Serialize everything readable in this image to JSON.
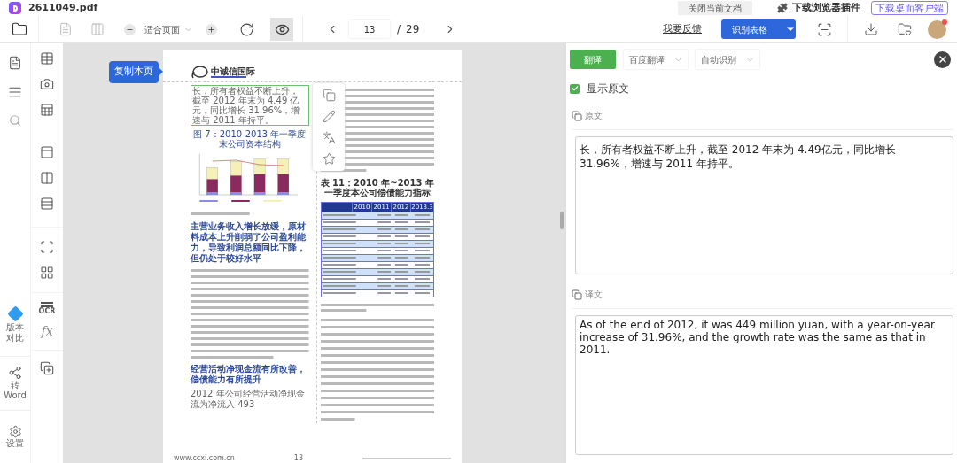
{
  "title_bar": {
    "filename": "2611049.pdf",
    "close_doc": "关闭当前文档",
    "plugin_link": "下载浏览器插件",
    "client_button": "下载桌面客户端"
  },
  "toolbar": {
    "zoom_mode": "适合页面",
    "page": "13",
    "separator": "/",
    "total": "29",
    "feedback": "我要反馈",
    "recognize_button": "识别表格",
    "preview_on": true,
    "has_notification": true
  },
  "left_rail": [
    {
      "label": "版本对比"
    },
    {
      "label": "转Word"
    },
    {
      "label": "设置"
    }
  ],
  "tool_rail": {
    "ocr_label": "OCR",
    "formula_label": "fx"
  },
  "tooltip": "复制本页",
  "document_page": {
    "logo": "中诚信国际",
    "highlighted_text": "长，所有者权益不断上升，截至 2012 年末为 4.49 亿元，同比增长 31.96%，增速与 2011 年持平。",
    "figure_title": "图 7：2010-2013 年一季度末公司资本结构",
    "section_headings": [
      "主营业务收入增长放缓，原材料成本上升削弱了公司盈利能力，导致利润总额同比下降，但仍处于较好水平",
      "经营活动净现金流有所改善，偿债能力有所提升"
    ],
    "last_line": "2012 年公司经营活动净现金流为净流入 493",
    "table_title": "表 11：2010 年~2013 年一季度本公司偿债能力指标",
    "table_columns": [
      "2010",
      "2011",
      "2012",
      "2013.3"
    ],
    "footer_url": "www.ccxi.com.cn",
    "page_number": "13"
  },
  "translate_panel": {
    "translate_button": "翻译",
    "engine": "百度翻译",
    "language": "自动识别",
    "show_original": {
      "label": "显示原文",
      "checked": true
    },
    "source_label": "原文",
    "source_text": "长，所有者权益不断上升，截至 2012 年末为 4.49亿元，同比增长 31.96%，增速与 2011 年持平。",
    "target_label": "译文",
    "target_text": "As of the end of 2012, it was 449 million yuan, with a year-on-year increase of 31.96%, and the growth rate was the same as that in 2011."
  }
}
